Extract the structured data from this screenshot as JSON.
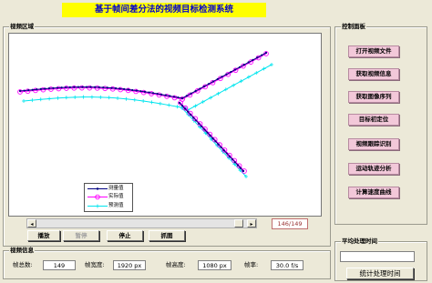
{
  "app": {
    "title": "基于帧间差分法的视频目标检测系统"
  },
  "video_area": {
    "label": "视频区域",
    "frame_counter": "146/149",
    "slider_fraction": 0.98
  },
  "legend": {
    "items": [
      {
        "label": "测量值",
        "color": "#000080",
        "marker": "point"
      },
      {
        "label": "实际值",
        "color": "#ff00ff",
        "marker": "circle"
      },
      {
        "label": "预测值",
        "color": "#00e5ee",
        "marker": "plus"
      }
    ]
  },
  "controls": {
    "play": "播放",
    "pause": "暂停",
    "stop": "停止",
    "capture": "抓图"
  },
  "control_panel": {
    "label": "控制面板",
    "buttons": [
      "打开视频文件",
      "获取视频信息",
      "获取图像序列",
      "目标初定位",
      "视频跟踪识别",
      "运动轨迹分析",
      "计算速度曲线"
    ]
  },
  "video_info": {
    "label": "视频信息",
    "fields": [
      {
        "label": "帧总数:",
        "value": "149"
      },
      {
        "label": "帧宽度:",
        "value": "1920 px"
      },
      {
        "label": "帧高度:",
        "value": "1080 px"
      },
      {
        "label": "帧率:",
        "value": "30.0 f/s"
      }
    ]
  },
  "processing_time": {
    "label": "平均处理时间",
    "value": "",
    "button": "统计处理时间"
  },
  "colors": {
    "title_bg": "#ffff00",
    "title_text": "#0000cc",
    "window_bg": "#ece9d8",
    "side_button_bg": "#f2c8d9"
  },
  "icons": {
    "scroll_left": "arrow-left-icon",
    "scroll_right": "arrow-right-icon"
  }
}
